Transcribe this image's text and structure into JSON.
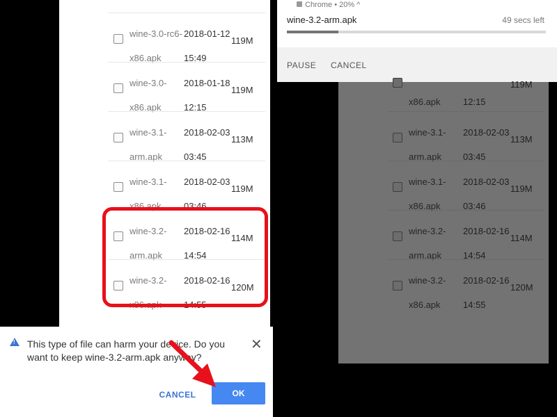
{
  "left": {
    "top_row": {
      "date_time": "15:49"
    },
    "files": [
      {
        "name": "wine-3.0-rc6-\nx86.apk",
        "date": "2018-01-12\n15:49",
        "size": "119M"
      },
      {
        "name": "wine-3.0-\nx86.apk",
        "date": "2018-01-18\n12:15",
        "size": "119M"
      },
      {
        "name": "wine-3.1-\narm.apk",
        "date": "2018-02-03\n03:45",
        "size": "113M"
      },
      {
        "name": "wine-3.1-\nx86.apk",
        "date": "2018-02-03\n03:46",
        "size": "119M"
      },
      {
        "name": "wine-3.2-\narm.apk",
        "date": "2018-02-16\n14:54",
        "size": "114M"
      },
      {
        "name": "wine-3.2-\nx86.apk",
        "date": "2018-02-16\n14:55",
        "size": "120M"
      }
    ],
    "dialog": {
      "message": "This type of file can harm your device. Do you want to keep wine-3.2-arm.apk anyway?",
      "cancel_label": "CANCEL",
      "ok_label": "OK",
      "close_glyph": "✕"
    },
    "highlight_color": "#e8101a"
  },
  "right": {
    "notification": {
      "app": "Chrome",
      "status_extra": "• 20% ^",
      "file_name": "wine-3.2-arm.apk",
      "time_left": "49 secs left",
      "progress_fraction": 0.2,
      "pause_label": "PAUSE",
      "cancel_label": "CANCEL"
    },
    "files": [
      {
        "name": "\nx86.apk",
        "date": "\n12:15",
        "size": "119M"
      },
      {
        "name": "wine-3.1-\narm.apk",
        "date": "2018-02-03\n03:45",
        "size": "113M"
      },
      {
        "name": "wine-3.1-\nx86.apk",
        "date": "2018-02-03\n03:46",
        "size": "119M"
      },
      {
        "name": "wine-3.2-\narm.apk",
        "date": "2018-02-16\n14:54",
        "size": "114M"
      },
      {
        "name": "wine-3.2-\nx86.apk",
        "date": "2018-02-16\n14:55",
        "size": "120M"
      }
    ]
  },
  "colors": {
    "accent": "#4688f1",
    "link": "#3b72d6"
  }
}
